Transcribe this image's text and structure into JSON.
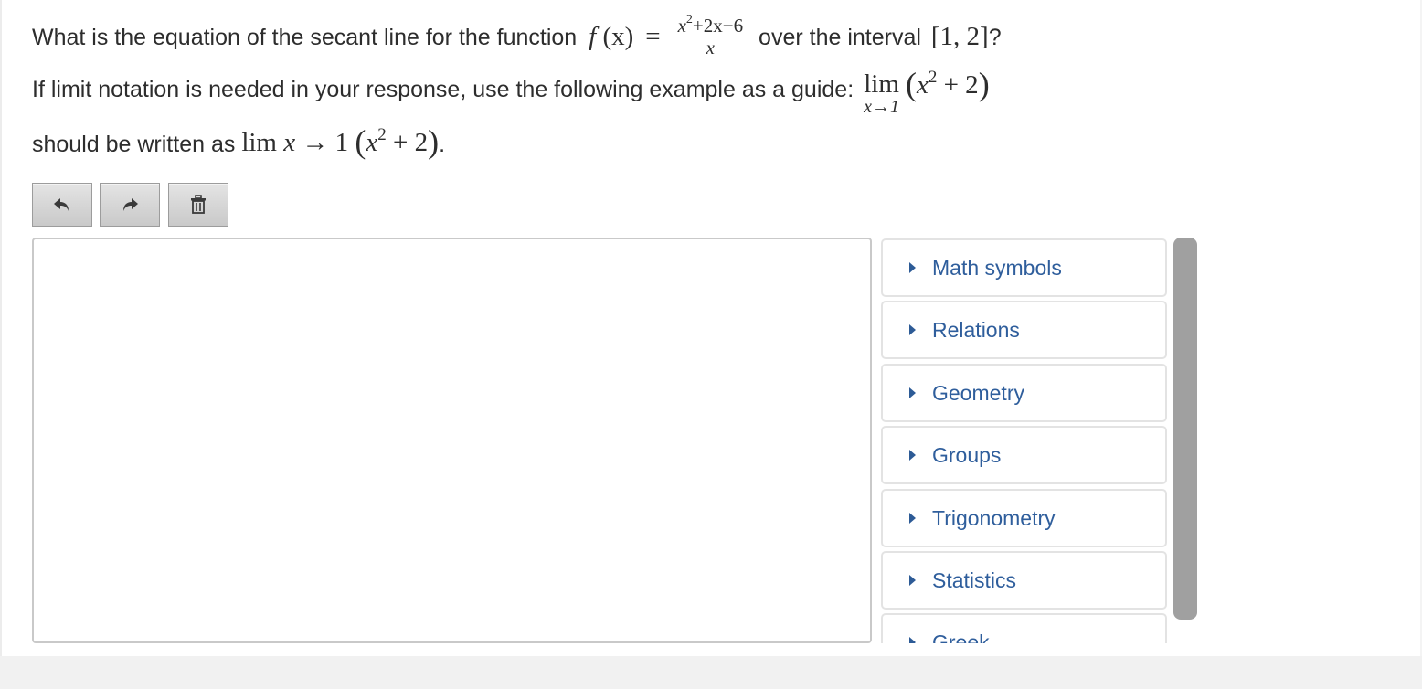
{
  "question": {
    "line1_prefix": "What is the equation of the secant line for the function",
    "func_f": "f",
    "func_arg": "(x)",
    "equals": "=",
    "frac_num_x": "x",
    "frac_num_exp": "2",
    "frac_num_rest": "+2x−6",
    "frac_den": "x",
    "line1_mid": "over the interval",
    "interval": "[1,  2]",
    "line1_end": "?",
    "line2_prefix": "If limit notation is needed in your response, use the following example as a guide:",
    "lim_word": "lim",
    "lim_sub": "x→1",
    "lim_paren_open": "(",
    "lim_expr_x": "x",
    "lim_expr_exp": "2",
    "lim_expr_rest": " + 2",
    "lim_paren_close": ")",
    "line3_prefix": "should be written as",
    "line3_lim": "lim",
    "line3_x": "x",
    "line3_arrow": " → 1 ",
    "line3_paren_open": "(",
    "line3_expr_x": "x",
    "line3_expr_exp": "2",
    "line3_expr_rest": " + 2",
    "line3_paren_close": ")",
    "line3_end": "."
  },
  "toolbar": {
    "undo_icon": "undo-icon",
    "redo_icon": "redo-icon",
    "delete_icon": "trash-icon"
  },
  "editor": {
    "value": ""
  },
  "palette": {
    "items": [
      {
        "label": "Math symbols"
      },
      {
        "label": "Relations"
      },
      {
        "label": "Geometry"
      },
      {
        "label": "Groups"
      },
      {
        "label": "Trigonometry"
      },
      {
        "label": "Statistics"
      },
      {
        "label": "Greek"
      }
    ],
    "caret_color": "#2d5b96",
    "label_color": "#2f5e9c"
  }
}
